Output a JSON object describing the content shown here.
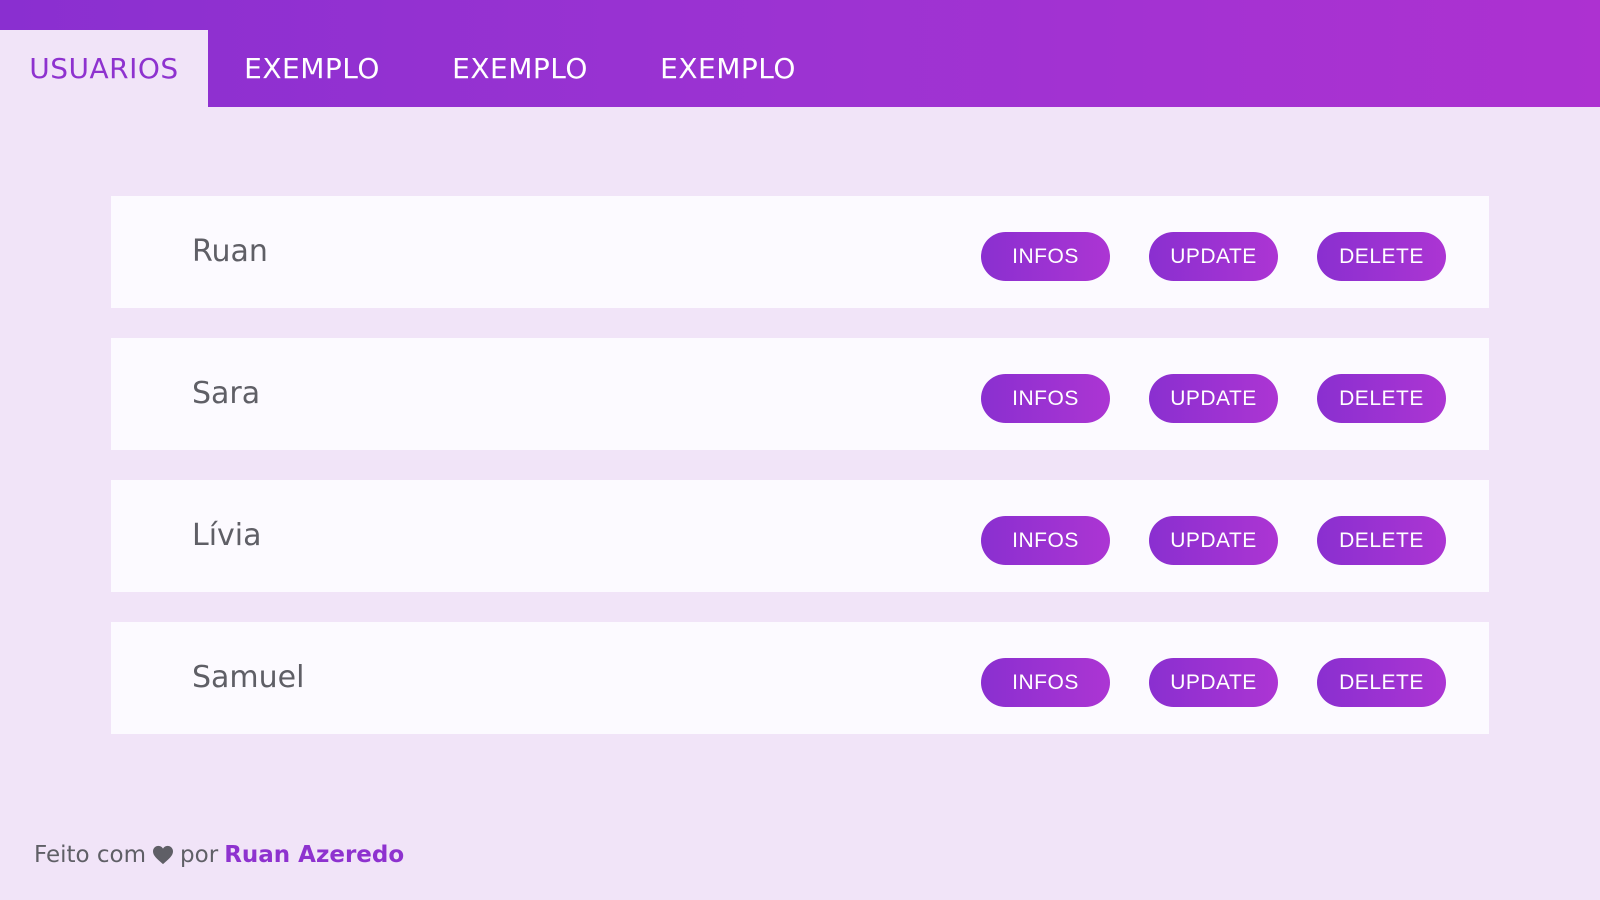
{
  "nav": {
    "tabs": [
      {
        "label": "USUARIOS",
        "active": true
      },
      {
        "label": "EXEMPLO",
        "active": false
      },
      {
        "label": "EXEMPLO",
        "active": false
      },
      {
        "label": "EXEMPLO",
        "active": false
      }
    ]
  },
  "users": [
    {
      "name": "Ruan"
    },
    {
      "name": "Sara"
    },
    {
      "name": "Lívia"
    },
    {
      "name": "Samuel"
    }
  ],
  "actions": {
    "infos_label": "INFOS",
    "update_label": "UPDATE",
    "delete_label": "DELETE"
  },
  "footer": {
    "made_with": "Feito com",
    "heart_icon": "heart-icon",
    "by": "por",
    "author": "Ruan Azeredo"
  },
  "colors": {
    "accent": "#8e32cf",
    "background": "#f1e4f8",
    "card": "#fcfaff",
    "text": "#5f5f66"
  }
}
